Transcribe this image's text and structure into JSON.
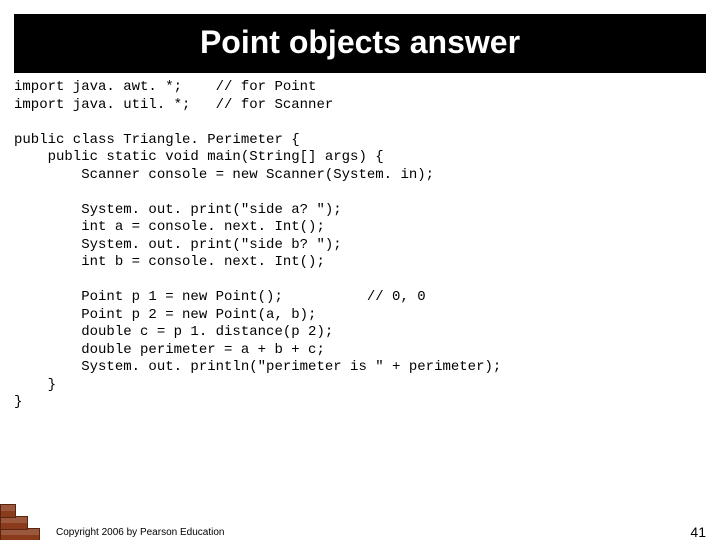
{
  "title": "Point objects answer",
  "code": "import java. awt. *;    // for Point\nimport java. util. *;   // for Scanner\n\npublic class Triangle. Perimeter {\n    public static void main(String[] args) {\n        Scanner console = new Scanner(System. in);\n\n        System. out. print(\"side a? \");\n        int a = console. next. Int();\n        System. out. print(\"side b? \");\n        int b = console. next. Int();\n\n        Point p 1 = new Point();          // 0, 0\n        Point p 2 = new Point(a, b);\n        double c = p 1. distance(p 2);\n        double perimeter = a + b + c;\n        System. out. println(\"perimeter is \" + perimeter);\n    }\n}",
  "footer": "Copyright 2006 by Pearson Education",
  "page_number": "41"
}
